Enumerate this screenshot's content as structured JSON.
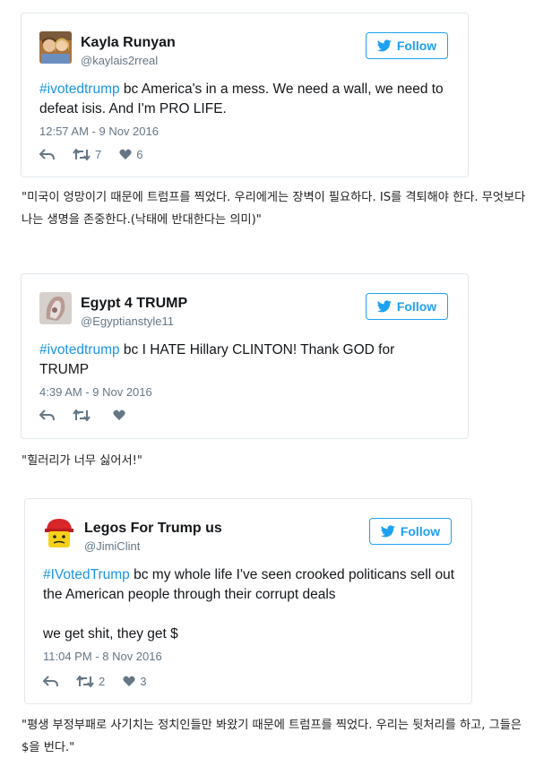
{
  "follow_label": "Follow",
  "tweets": [
    {
      "name": "Kayla Runyan",
      "handle": "@kaylais2rreal",
      "hashtag": "#ivotedtrump",
      "text": " bc America's in a mess. We need a wall, we need to defeat isis. And I'm PRO LIFE.",
      "time": "12:57 AM - 9 Nov 2016",
      "retweets": "7",
      "likes": "6",
      "avatar_icon": "profile-photo"
    },
    {
      "name": "Egypt 4 TRUMP",
      "handle": "@Egyptianstyle11",
      "hashtag": "#ivotedtrump",
      "text": " bc I HATE Hillary CLINTON! Thank GOD for TRUMP",
      "time": "4:39 AM - 9 Nov 2016",
      "retweets": "",
      "likes": "",
      "avatar_icon": "profile-photo"
    },
    {
      "name": "Legos For Trump us",
      "handle": "@JimiClint",
      "hashtag": "#IVotedTrump",
      "text": " bc my whole life I've seen crooked politicans sell out the American people through their corrupt deals",
      "text2": "we get shit, they get $",
      "time": "11:04 PM - 8 Nov 2016",
      "retweets": "2",
      "likes": "3",
      "avatar_icon": "lego-head-red-cap"
    }
  ],
  "captions": [
    "\"미국이 엉망이기 때문에 트럼프를 찍었다. 우리에게는 장벽이 필요하다. IS를 격퇴해야 한다. 무엇보다 나는 생명을 존중한다.(낙태에 반대한다는 의미)\"",
    "\"힐러리가 너무 싫어서!\"",
    "\"평생 부정부패로 사기치는 정치인들만 봐왔기 때문에 트럼프를 찍었다. 우리는 뒷처리를 하고, 그들은 $을 번다.\""
  ],
  "colors": {
    "accent": "#1da1f2",
    "hashtag": "#1b95e0",
    "muted": "#657786",
    "border": "#e1e8ed"
  }
}
